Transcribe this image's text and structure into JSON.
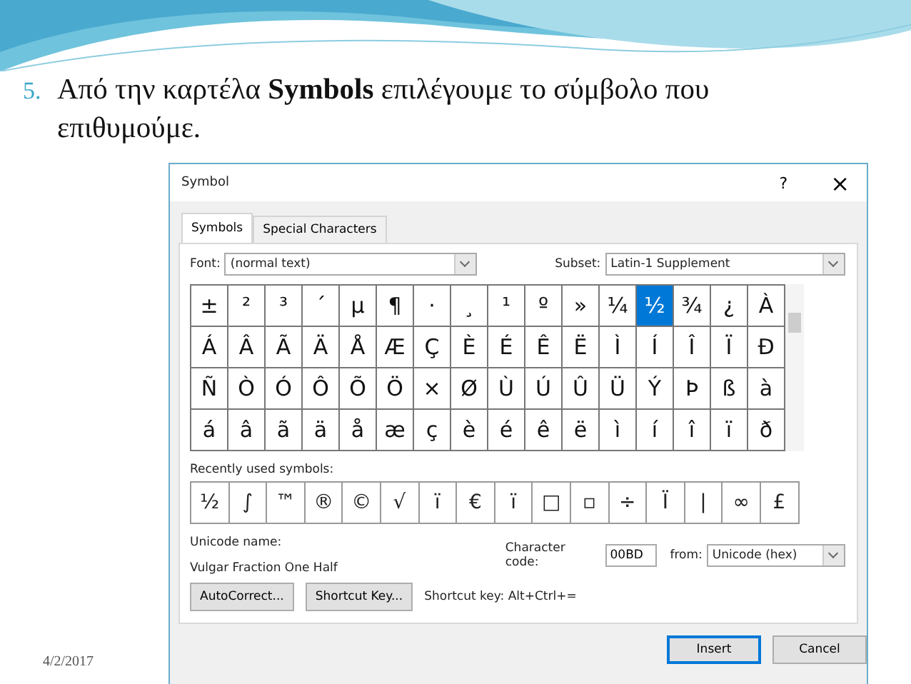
{
  "slide": {
    "number": "5.",
    "text": "Από την καρτέλα **Symbols** επιλέγουμε το σύμβολο που επιθυμούμε.",
    "date": "4/2/2017"
  },
  "dialog": {
    "title": "Symbol",
    "help": "?",
    "close": "×",
    "tabs": [
      {
        "label": "Symbols",
        "selected": true
      },
      {
        "label": "Special Characters",
        "selected": false
      }
    ],
    "font": {
      "label": "Font:",
      "value": "(normal text)"
    },
    "subset": {
      "label": "Subset:",
      "value": "Latin-1 Supplement"
    },
    "symbols": [
      {
        "char": "±",
        "selected": false
      },
      {
        "char": "²",
        "selected": false
      },
      {
        "char": "³",
        "selected": false
      },
      {
        "char": "´",
        "selected": false
      },
      {
        "char": "µ",
        "selected": false
      },
      {
        "char": "¶",
        "selected": false
      },
      {
        "char": "·",
        "selected": false
      },
      {
        "char": "¸",
        "selected": false
      },
      {
        "char": "¹",
        "selected": false
      },
      {
        "char": "º",
        "selected": false
      },
      {
        "char": "»",
        "selected": false
      },
      {
        "char": "¼",
        "selected": false
      },
      {
        "char": "½",
        "selected": true
      },
      {
        "char": "¾",
        "selected": false
      },
      {
        "char": "¿",
        "selected": false
      },
      {
        "char": "À",
        "selected": false
      },
      {
        "char": "Á",
        "selected": false
      },
      {
        "char": "Â",
        "selected": false
      },
      {
        "char": "Ã",
        "selected": false
      },
      {
        "char": "Ä",
        "selected": false
      },
      {
        "char": "Å",
        "selected": false
      },
      {
        "char": "Æ",
        "selected": false
      },
      {
        "char": "Ç",
        "selected": false
      },
      {
        "char": "È",
        "selected": false
      },
      {
        "char": "É",
        "selected": false
      },
      {
        "char": "Ê",
        "selected": false
      },
      {
        "char": "Ë",
        "selected": false
      },
      {
        "char": "Ì",
        "selected": false
      },
      {
        "char": "Í",
        "selected": false
      },
      {
        "char": "Î",
        "selected": false
      },
      {
        "char": "Ï",
        "selected": false
      },
      {
        "char": "Ð",
        "selected": false
      },
      {
        "char": "Ñ",
        "selected": false
      },
      {
        "char": "Ò",
        "selected": false
      },
      {
        "char": "Ó",
        "selected": false
      },
      {
        "char": "Ô",
        "selected": false
      },
      {
        "char": "Õ",
        "selected": false
      },
      {
        "char": "Ö",
        "selected": false
      },
      {
        "char": "×",
        "selected": false
      },
      {
        "char": "Ø",
        "selected": false
      },
      {
        "char": "Ù",
        "selected": false
      },
      {
        "char": "Ú",
        "selected": false
      },
      {
        "char": "Û",
        "selected": false
      },
      {
        "char": "Ü",
        "selected": false
      },
      {
        "char": "Ý",
        "selected": false
      },
      {
        "char": "Þ",
        "selected": false
      },
      {
        "char": "ß",
        "selected": false
      },
      {
        "char": "à",
        "selected": false
      },
      {
        "char": "á",
        "selected": false
      },
      {
        "char": "â",
        "selected": false
      },
      {
        "char": "ã",
        "selected": false
      },
      {
        "char": "ä",
        "selected": false
      },
      {
        "char": "å",
        "selected": false
      },
      {
        "char": "æ",
        "selected": false
      },
      {
        "char": "ç",
        "selected": false
      },
      {
        "char": "è",
        "selected": false
      },
      {
        "char": "é",
        "selected": false
      },
      {
        "char": "ê",
        "selected": false
      },
      {
        "char": "ë",
        "selected": false
      },
      {
        "char": "ì",
        "selected": false
      },
      {
        "char": "í",
        "selected": false
      },
      {
        "char": "î",
        "selected": false
      },
      {
        "char": "ï",
        "selected": false
      },
      {
        "char": "ð",
        "selected": false
      }
    ],
    "recent_label": "Recently used symbols:",
    "recent": [
      "½",
      "∫",
      "™",
      "®",
      "©",
      "√",
      "ï",
      "€",
      "ï",
      "□",
      "▫",
      "÷",
      "Ï",
      "|",
      "∞",
      "£"
    ],
    "unicode_name_label": "Unicode name:",
    "unicode_name": "Vulgar Fraction One Half",
    "character_code": {
      "label": "Character code:",
      "value": "00BD"
    },
    "from": {
      "label": "from:",
      "value": "Unicode (hex)"
    },
    "buttons": [
      "AutoCorrect...",
      "Shortcut Key..."
    ],
    "shortcut_text": "Shortcut key: Alt+Ctrl+=",
    "insert": "Insert",
    "cancel": "Cancel"
  }
}
